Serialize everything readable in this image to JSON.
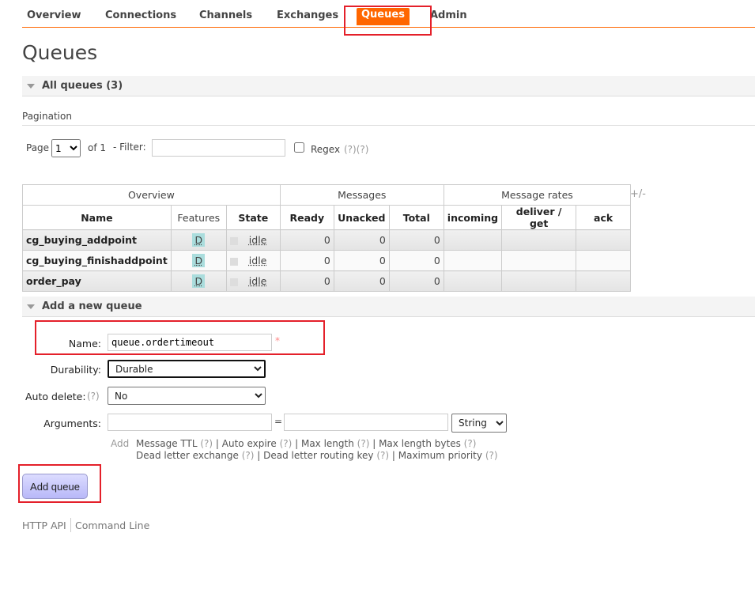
{
  "nav": {
    "tabs": [
      "Overview",
      "Connections",
      "Channels",
      "Exchanges",
      "Queues",
      "Admin"
    ],
    "active": "Queues"
  },
  "page_title": "Queues",
  "all_queues": {
    "title": "All queues (3)"
  },
  "pagination": {
    "label": "Pagination",
    "page_label": "Page",
    "page_value": "1",
    "of_label": "of 1",
    "filter_label": "- Filter:",
    "filter_value": "",
    "regex_label": "Regex",
    "regex_help": "(?)(?)",
    "regex_checked": false,
    "toggle_columns": "+/-"
  },
  "table": {
    "groups": [
      "Overview",
      "Messages",
      "Message rates"
    ],
    "columns": [
      "Name",
      "Features",
      "State",
      "Ready",
      "Unacked",
      "Total",
      "incoming",
      "deliver / get",
      "ack"
    ],
    "rows": [
      {
        "name": "cg_buying_addpoint",
        "features": "D",
        "state": "idle",
        "ready": "0",
        "unacked": "0",
        "total": "0",
        "incoming": "",
        "deliver_get": "",
        "ack": ""
      },
      {
        "name": "cg_buying_finishaddpoint",
        "features": "D",
        "state": "idle",
        "ready": "0",
        "unacked": "0",
        "total": "0",
        "incoming": "",
        "deliver_get": "",
        "ack": ""
      },
      {
        "name": "order_pay",
        "features": "D",
        "state": "idle",
        "ready": "0",
        "unacked": "0",
        "total": "0",
        "incoming": "",
        "deliver_get": "",
        "ack": ""
      }
    ]
  },
  "add_queue": {
    "title": "Add a new queue",
    "name_label": "Name:",
    "name_value": "queue.ordertimeout",
    "required": "*",
    "durability_label": "Durability:",
    "durability_value": "Durable",
    "auto_delete_label": "Auto delete:",
    "help": "(?)",
    "auto_delete_value": "No",
    "arguments_label": "Arguments:",
    "equals": "=",
    "arg_type": "String",
    "add_label": "Add",
    "arg_links_1": [
      {
        "label": "Message TTL"
      },
      {
        "label": "Auto expire"
      },
      {
        "label": "Max length"
      },
      {
        "label": "Max length bytes"
      }
    ],
    "arg_links_2": [
      {
        "label": "Dead letter exchange"
      },
      {
        "label": "Dead letter routing key"
      },
      {
        "label": "Maximum priority"
      }
    ],
    "button": "Add queue"
  },
  "footer": {
    "links": [
      "HTTP API",
      "Command Line"
    ]
  },
  "colors": {
    "accent": "#ff6600",
    "annotation": "#e4202a",
    "button": "#c8c8fc"
  }
}
